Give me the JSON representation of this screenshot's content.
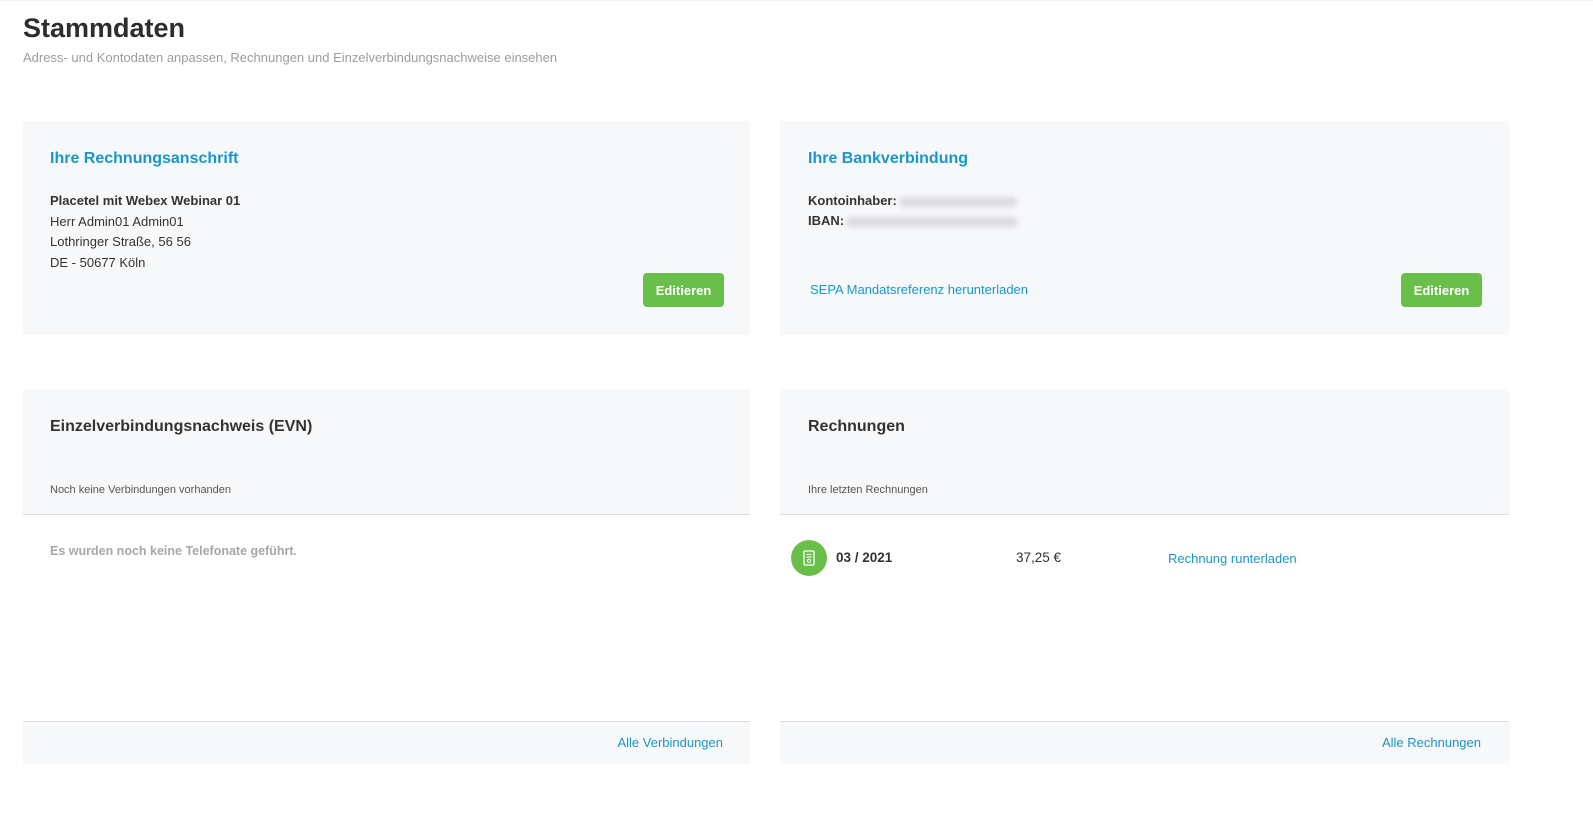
{
  "header": {
    "title": "Stammdaten",
    "subtitle": "Adress- und Kontodaten anpassen, Rechnungen und Einzelverbindungsnachweise einsehen"
  },
  "billing_address": {
    "title": "Ihre Rechnungsanschrift",
    "company": "Placetel mit Webex Webinar 01",
    "contact": "Herr Admin01 Admin01",
    "street": "Lothringer Straße, 56 56",
    "city": "DE - 50677 Köln",
    "edit_label": "Editieren"
  },
  "bank": {
    "title": "Ihre Bankverbindung",
    "holder_label": "Kontoinhaber:",
    "iban_label": "IBAN:",
    "sepa_link": "SEPA Mandatsreferenz herunterladen",
    "edit_label": "Editieren"
  },
  "evn": {
    "title": "Einzelverbindungsnachweis (EVN)",
    "subtitle": "Noch keine Verbindungen vorhanden",
    "empty_message": "Es wurden noch keine Telefonate geführt.",
    "footer_link": "Alle Verbindungen"
  },
  "invoices": {
    "title": "Rechnungen",
    "subtitle": "Ihre letzten Rechnungen",
    "items": [
      {
        "period": "03 / 2021",
        "amount": "37,25 €",
        "download_label": "Rechnung runterladen",
        "icon": "invoice-document-icon"
      }
    ],
    "footer_link": "Alle Rechnungen"
  },
  "colors": {
    "accent_blue": "#1a96c8",
    "button_green": "#6abf4b",
    "card_bg": "#f7f8fa"
  }
}
